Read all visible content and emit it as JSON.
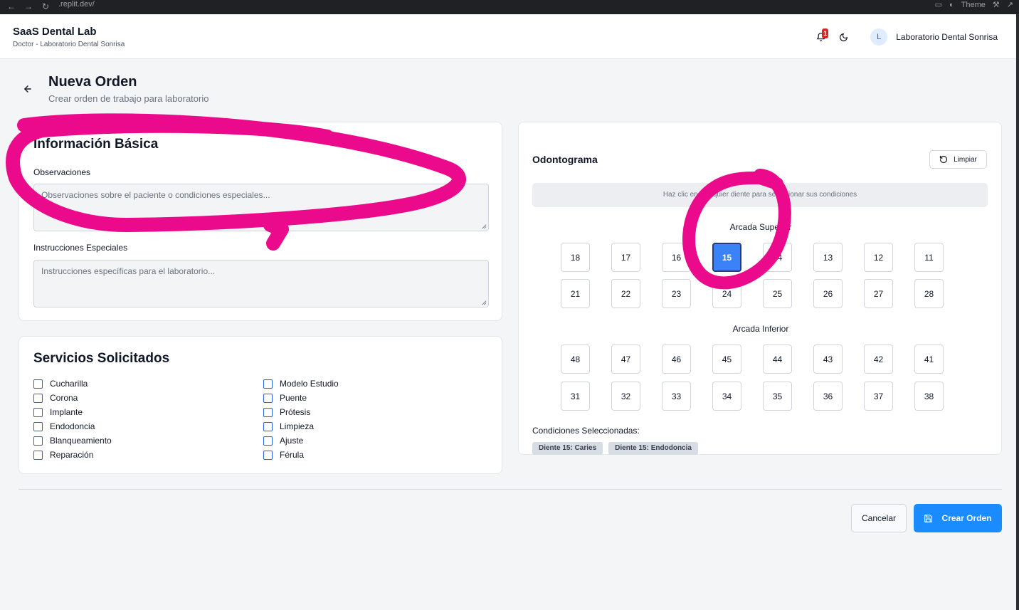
{
  "browser": {
    "url": ".replit.dev/",
    "theme_label": "Theme"
  },
  "header": {
    "app_title": "SaaS Dental Lab",
    "app_subtitle": "Doctor - Laboratorio Dental Sonrisa",
    "notification_count": "1",
    "avatar_initial": "L",
    "user_name": "Laboratorio Dental Sonrisa"
  },
  "page": {
    "title": "Nueva Orden",
    "subtitle": "Crear orden de trabajo para laboratorio"
  },
  "info_card": {
    "title": "Información Básica",
    "observaciones_label": "Observaciones",
    "observaciones_placeholder": "Observaciones sobre el paciente o condiciones especiales...",
    "instrucciones_label": "Instrucciones Especiales",
    "instrucciones_placeholder": "Instrucciones específicas para el laboratorio..."
  },
  "services_card": {
    "title": "Servicios Solicitados",
    "left": [
      "Cucharilla",
      "Corona",
      "Implante",
      "Endodoncia",
      "Blanqueamiento",
      "Reparación"
    ],
    "right": [
      "Modelo Estudio",
      "Puente",
      "Prótesis",
      "Limpieza",
      "Ajuste",
      "Férula"
    ]
  },
  "odontogram": {
    "title": "Odontograma",
    "clear_label": "Limpiar",
    "hint": "Haz clic en cualquier diente para seleccionar sus condiciones",
    "upper_label": "Arcada Superior",
    "lower_label": "Arcada Inferior",
    "upper_row1": [
      "18",
      "17",
      "16",
      "15",
      "14",
      "13",
      "12",
      "11"
    ],
    "upper_row2": [
      "21",
      "22",
      "23",
      "24",
      "25",
      "26",
      "27",
      "28"
    ],
    "lower_row1": [
      "48",
      "47",
      "46",
      "45",
      "44",
      "43",
      "42",
      "41"
    ],
    "lower_row2": [
      "31",
      "32",
      "33",
      "34",
      "35",
      "36",
      "37",
      "38"
    ],
    "selected_tooth": "15",
    "conditions_label": "Condiciones Seleccionadas:",
    "conditions": [
      "Diente 15: Caries",
      "Diente 15: Endodoncia"
    ]
  },
  "actions": {
    "cancel_label": "Cancelar",
    "create_label": "Crear Orden"
  },
  "colors": {
    "primary": "#1a8cff",
    "selected_tooth": "#3b82f6",
    "annotation": "#ec0a8c",
    "badge": "#dc2626"
  }
}
